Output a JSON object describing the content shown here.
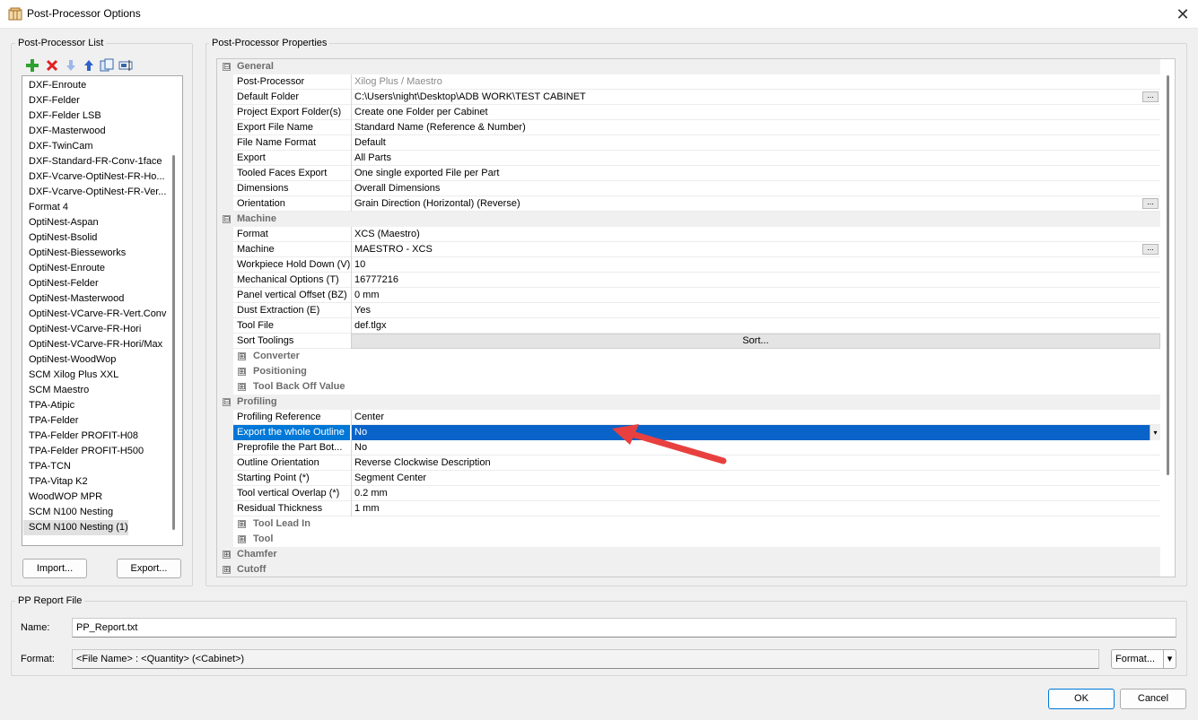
{
  "window": {
    "title": "Post-Processor Options",
    "close_glyph": "✕"
  },
  "list_group": {
    "label": "Post-Processor List"
  },
  "toolbar": {
    "icons": [
      "add-icon",
      "delete-icon",
      "move-down-icon",
      "move-up-icon",
      "copy-icon",
      "rename-icon"
    ]
  },
  "pp_list": [
    "DXF-Enroute",
    "DXF-Felder",
    "DXF-Felder LSB",
    "DXF-Masterwood",
    "DXF-TwinCam",
    "DXF-Standard-FR-Conv-1face",
    "DXF-Vcarve-OptiNest-FR-Ho...",
    "DXF-Vcarve-OptiNest-FR-Ver...",
    "Format 4",
    "OptiNest-Aspan",
    "OptiNest-Bsolid",
    "OptiNest-Biesseworks",
    "OptiNest-Enroute",
    "OptiNest-Felder",
    "OptiNest-Masterwood",
    "OptiNest-VCarve-FR-Vert.Conv",
    "OptiNest-VCarve-FR-Hori",
    "OptiNest-VCarve-FR-Hori/Max",
    "OptiNest-WoodWop",
    "SCM Xilog Plus XXL",
    "SCM Maestro",
    "TPA-Atipic",
    "TPA-Felder",
    "TPA-Felder PROFIT-H08",
    "TPA-Felder PROFIT-H500",
    "TPA-TCN",
    "TPA-Vitap K2",
    "WoodWOP MPR",
    "SCM N100 Nesting",
    "SCM N100 Nesting (1)"
  ],
  "pp_selected_index": 29,
  "list_buttons": {
    "import": "Import...",
    "export": "Export..."
  },
  "props_group": {
    "label": "Post-Processor Properties"
  },
  "grid_rows": [
    {
      "kind": "cat",
      "name": "General",
      "exp": "⊟"
    },
    {
      "kind": "prop",
      "name": "Post-Processor",
      "value": "Xilog Plus / Maestro",
      "grey": true
    },
    {
      "kind": "prop",
      "name": "Default Folder",
      "value": "C:\\Users\\night\\Desktop\\ADB WORK\\TEST CABINET",
      "ellipsis": "..."
    },
    {
      "kind": "prop",
      "name": "Project Export Folder(s)",
      "value": "Create one Folder per Cabinet"
    },
    {
      "kind": "prop",
      "name": "Export File Name",
      "value": "Standard Name (Reference & Number)"
    },
    {
      "kind": "prop",
      "name": "File Name Format",
      "value": "Default"
    },
    {
      "kind": "prop",
      "name": "Export",
      "value": "All Parts"
    },
    {
      "kind": "prop",
      "name": "Tooled Faces Export",
      "value": "One single exported File per Part"
    },
    {
      "kind": "prop",
      "name": "Dimensions",
      "value": "Overall Dimensions"
    },
    {
      "kind": "prop",
      "name": "Orientation",
      "value": "Grain Direction (Horizontal) (Reverse)",
      "ellipsis": "..."
    },
    {
      "kind": "cat",
      "name": "Machine",
      "exp": "⊟"
    },
    {
      "kind": "prop",
      "name": "Format",
      "value": "XCS (Maestro)"
    },
    {
      "kind": "prop",
      "name": "Machine",
      "value": "MAESTRO - XCS",
      "ellipsis": "..."
    },
    {
      "kind": "prop",
      "name": "Workpiece Hold Down (V)",
      "value": "10"
    },
    {
      "kind": "prop",
      "name": "Mechanical Options (T)",
      "value": "16777216"
    },
    {
      "kind": "prop",
      "name": "Panel vertical Offset (BZ)",
      "value": "0 mm"
    },
    {
      "kind": "prop",
      "name": "Dust Extraction (E)",
      "value": "Yes"
    },
    {
      "kind": "prop",
      "name": "Tool File",
      "value": "def.tlgx"
    },
    {
      "kind": "button",
      "name": "Sort Toolings",
      "value": "Sort..."
    },
    {
      "kind": "sub",
      "name": "Converter",
      "exp": "⊞"
    },
    {
      "kind": "sub",
      "name": "Positioning",
      "exp": "⊞"
    },
    {
      "kind": "sub",
      "name": "Tool Back Off Value",
      "exp": "⊞"
    },
    {
      "kind": "cat",
      "name": "Profiling",
      "exp": "⊟"
    },
    {
      "kind": "prop",
      "name": "Profiling Reference",
      "value": "Center"
    },
    {
      "kind": "prop",
      "name": "Export the whole Outline",
      "value": "No",
      "selected": true,
      "dropdown": "▾"
    },
    {
      "kind": "prop",
      "name": "Preprofile the Part Bot...",
      "value": "No"
    },
    {
      "kind": "prop",
      "name": "Outline Orientation",
      "value": "Reverse Clockwise Description"
    },
    {
      "kind": "prop",
      "name": "Starting Point (*)",
      "value": "Segment Center"
    },
    {
      "kind": "prop",
      "name": "Tool vertical Overlap (*)",
      "value": "0.2 mm"
    },
    {
      "kind": "prop",
      "name": "Residual Thickness",
      "value": "1 mm"
    },
    {
      "kind": "sub",
      "name": "Tool Lead In",
      "exp": "⊞"
    },
    {
      "kind": "sub",
      "name": "Tool",
      "exp": "⊞"
    },
    {
      "kind": "cat",
      "name": "Chamfer",
      "exp": "⊞"
    },
    {
      "kind": "cat",
      "name": "Cutoff",
      "exp": "⊞"
    }
  ],
  "report": {
    "group_label": "PP Report File",
    "name_label": "Name:",
    "name_value": "PP_Report.txt",
    "format_label": "Format:",
    "format_value": "<File Name> : <Quantity> (<Cabinet>)",
    "format_button": "Format...",
    "format_arrow": "▾"
  },
  "dialog_buttons": {
    "ok": "OK",
    "cancel": "Cancel"
  },
  "colors": {
    "selection": "#0078d7",
    "arrow": "#e8403f"
  }
}
